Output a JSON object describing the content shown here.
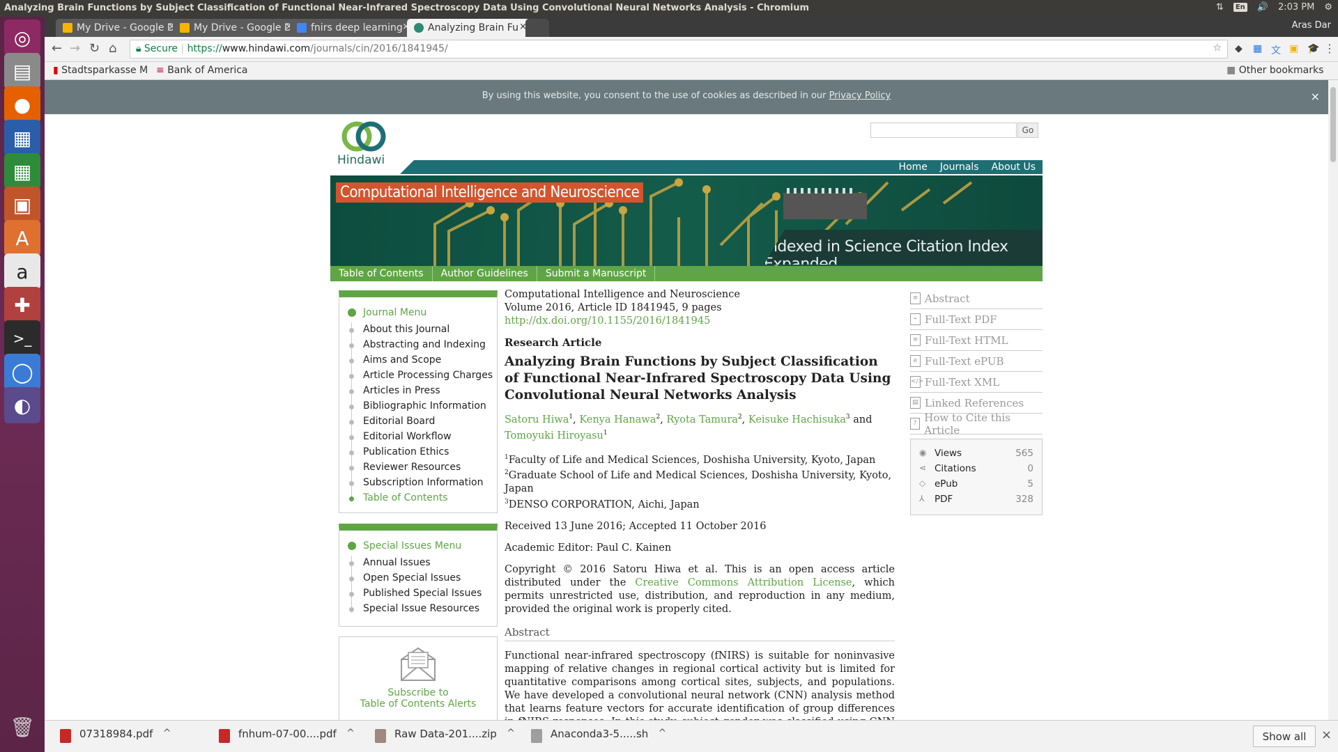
{
  "window": {
    "title": "Analyzing Brain Functions by Subject Classification of Functional Near-Infrared Spectroscopy Data Using Convolutional Neural Networks Analysis - Chromium",
    "tray_lang": "En",
    "time": "2:03 PM",
    "user": "Aras Dar"
  },
  "tabs": [
    {
      "label": "My Drive - Google D",
      "icon_color": "#f4b400"
    },
    {
      "label": "My Drive - Google D",
      "icon_color": "#f4b400"
    },
    {
      "label": "fnirs deep learning",
      "icon_color": "#4285f4"
    },
    {
      "label": "Analyzing Brain Fu",
      "icon_color": "#2c8a75",
      "active": true
    }
  ],
  "omnibox": {
    "secure_label": "Secure",
    "url_scheme": "https://",
    "url_host": "www.hindawi.com",
    "url_path": "/journals/cin/2016/1841945/"
  },
  "bookmarks": {
    "items": [
      "Stadtsparkasse M",
      "Bank of America"
    ],
    "other": "Other bookmarks"
  },
  "cookie": {
    "text": "By using this website, you consent to the use of cookies as described in our",
    "link": "Privacy Policy",
    "close": "×"
  },
  "site": {
    "logo_text": "Hindawi",
    "search_placeholder": "",
    "go_label": "Go",
    "topnav": [
      "Home",
      "Journals",
      "About Us"
    ],
    "journal_title": "Computational Intelligence and Neuroscience",
    "indexed": "Indexed in Science Citation Index Expanded",
    "subnav": [
      "Table of Contents",
      "Author Guidelines",
      "Submit a Manuscript"
    ]
  },
  "journal_menu": {
    "title": "Journal Menu",
    "items": [
      "About this Journal",
      "Abstracting and Indexing",
      "Aims and Scope",
      "Article Processing Charges",
      "Articles in Press",
      "Bibliographic Information",
      "Editorial Board",
      "Editorial Workflow",
      "Publication Ethics",
      "Reviewer Resources",
      "Subscription Information",
      "Table of Contents"
    ]
  },
  "special_menu": {
    "title": "Special Issues Menu",
    "items": [
      "Annual Issues",
      "Open Special Issues",
      "Published Special Issues",
      "Special Issue Resources"
    ]
  },
  "alerts": {
    "line1": "Subscribe to",
    "line2": "Table of Contents Alerts"
  },
  "article": {
    "journal": "Computational Intelligence and Neuroscience",
    "volume": "Volume 2016, Article ID 1841945, 9 pages",
    "doi": "http://dx.doi.org/10.1155/2016/1841945",
    "type": "Research Article",
    "title": "Analyzing Brain Functions by Subject Classification of Functional Near-Infrared Spectroscopy Data Using Convolutional Neural Networks Analysis",
    "authors": [
      {
        "name": "Satoru Hiwa",
        "aff": "1"
      },
      {
        "name": "Kenya Hanawa",
        "aff": "2"
      },
      {
        "name": "Ryota Tamura",
        "aff": "2"
      },
      {
        "name": "Keisuke Hachisuka",
        "aff": "3"
      },
      {
        "name": "Tomoyuki Hiroyasu",
        "aff": "1"
      }
    ],
    "and": "and",
    "affiliations": [
      {
        "n": "1",
        "text": "Faculty of Life and Medical Sciences, Doshisha University, Kyoto, Japan"
      },
      {
        "n": "2",
        "text": "Graduate School of Life and Medical Sciences, Doshisha University, Kyoto, Japan"
      },
      {
        "n": "3",
        "text": "DENSO CORPORATION, Aichi, Japan"
      }
    ],
    "received": "Received 13 June 2016; Accepted 11 October 2016",
    "editor": "Academic Editor: Paul C. Kainen",
    "copyright_pre": "Copyright © 2016 Satoru Hiwa et al. This is an open access article distributed under the",
    "copyright_link": "Creative Commons Attribution License",
    "copyright_post": ", which permits unrestricted use, distribution, and reproduction in any medium, provided the original work is properly cited.",
    "abstract_heading": "Abstract",
    "abstract": "Functional near-infrared spectroscopy (fNIRS) is suitable for noninvasive mapping of relative changes in regional cortical activity but is limited for quantitative comparisons among cortical sites, subjects, and populations. We have developed a convolutional neural network (CNN) analysis method that learns feature vectors for accurate identification of group differences in fNIRS responses. In this study, subject gender was classified using CNN analysis of fNIRS data. fNIRS data were acquired from male and female subjects during a"
  },
  "right_links": [
    "Abstract",
    "Full-Text PDF",
    "Full-Text HTML",
    "Full-Text ePUB",
    "Full-Text XML",
    "Linked References",
    "How to Cite this Article"
  ],
  "metrics": [
    {
      "label": "Views",
      "value": "565"
    },
    {
      "label": "Citations",
      "value": "0"
    },
    {
      "label": "ePub",
      "value": "5"
    },
    {
      "label": "PDF",
      "value": "328"
    }
  ],
  "downloads": [
    {
      "name": "07318984.pdf",
      "color": "#c62828"
    },
    {
      "name": "fnhum-07-00....pdf",
      "color": "#c62828"
    },
    {
      "name": "Raw Data-201....zip",
      "color": "#a1887f"
    },
    {
      "name": "Anaconda3-5.....sh",
      "color": "#9e9e9e"
    }
  ],
  "download_show_all": "Show all"
}
